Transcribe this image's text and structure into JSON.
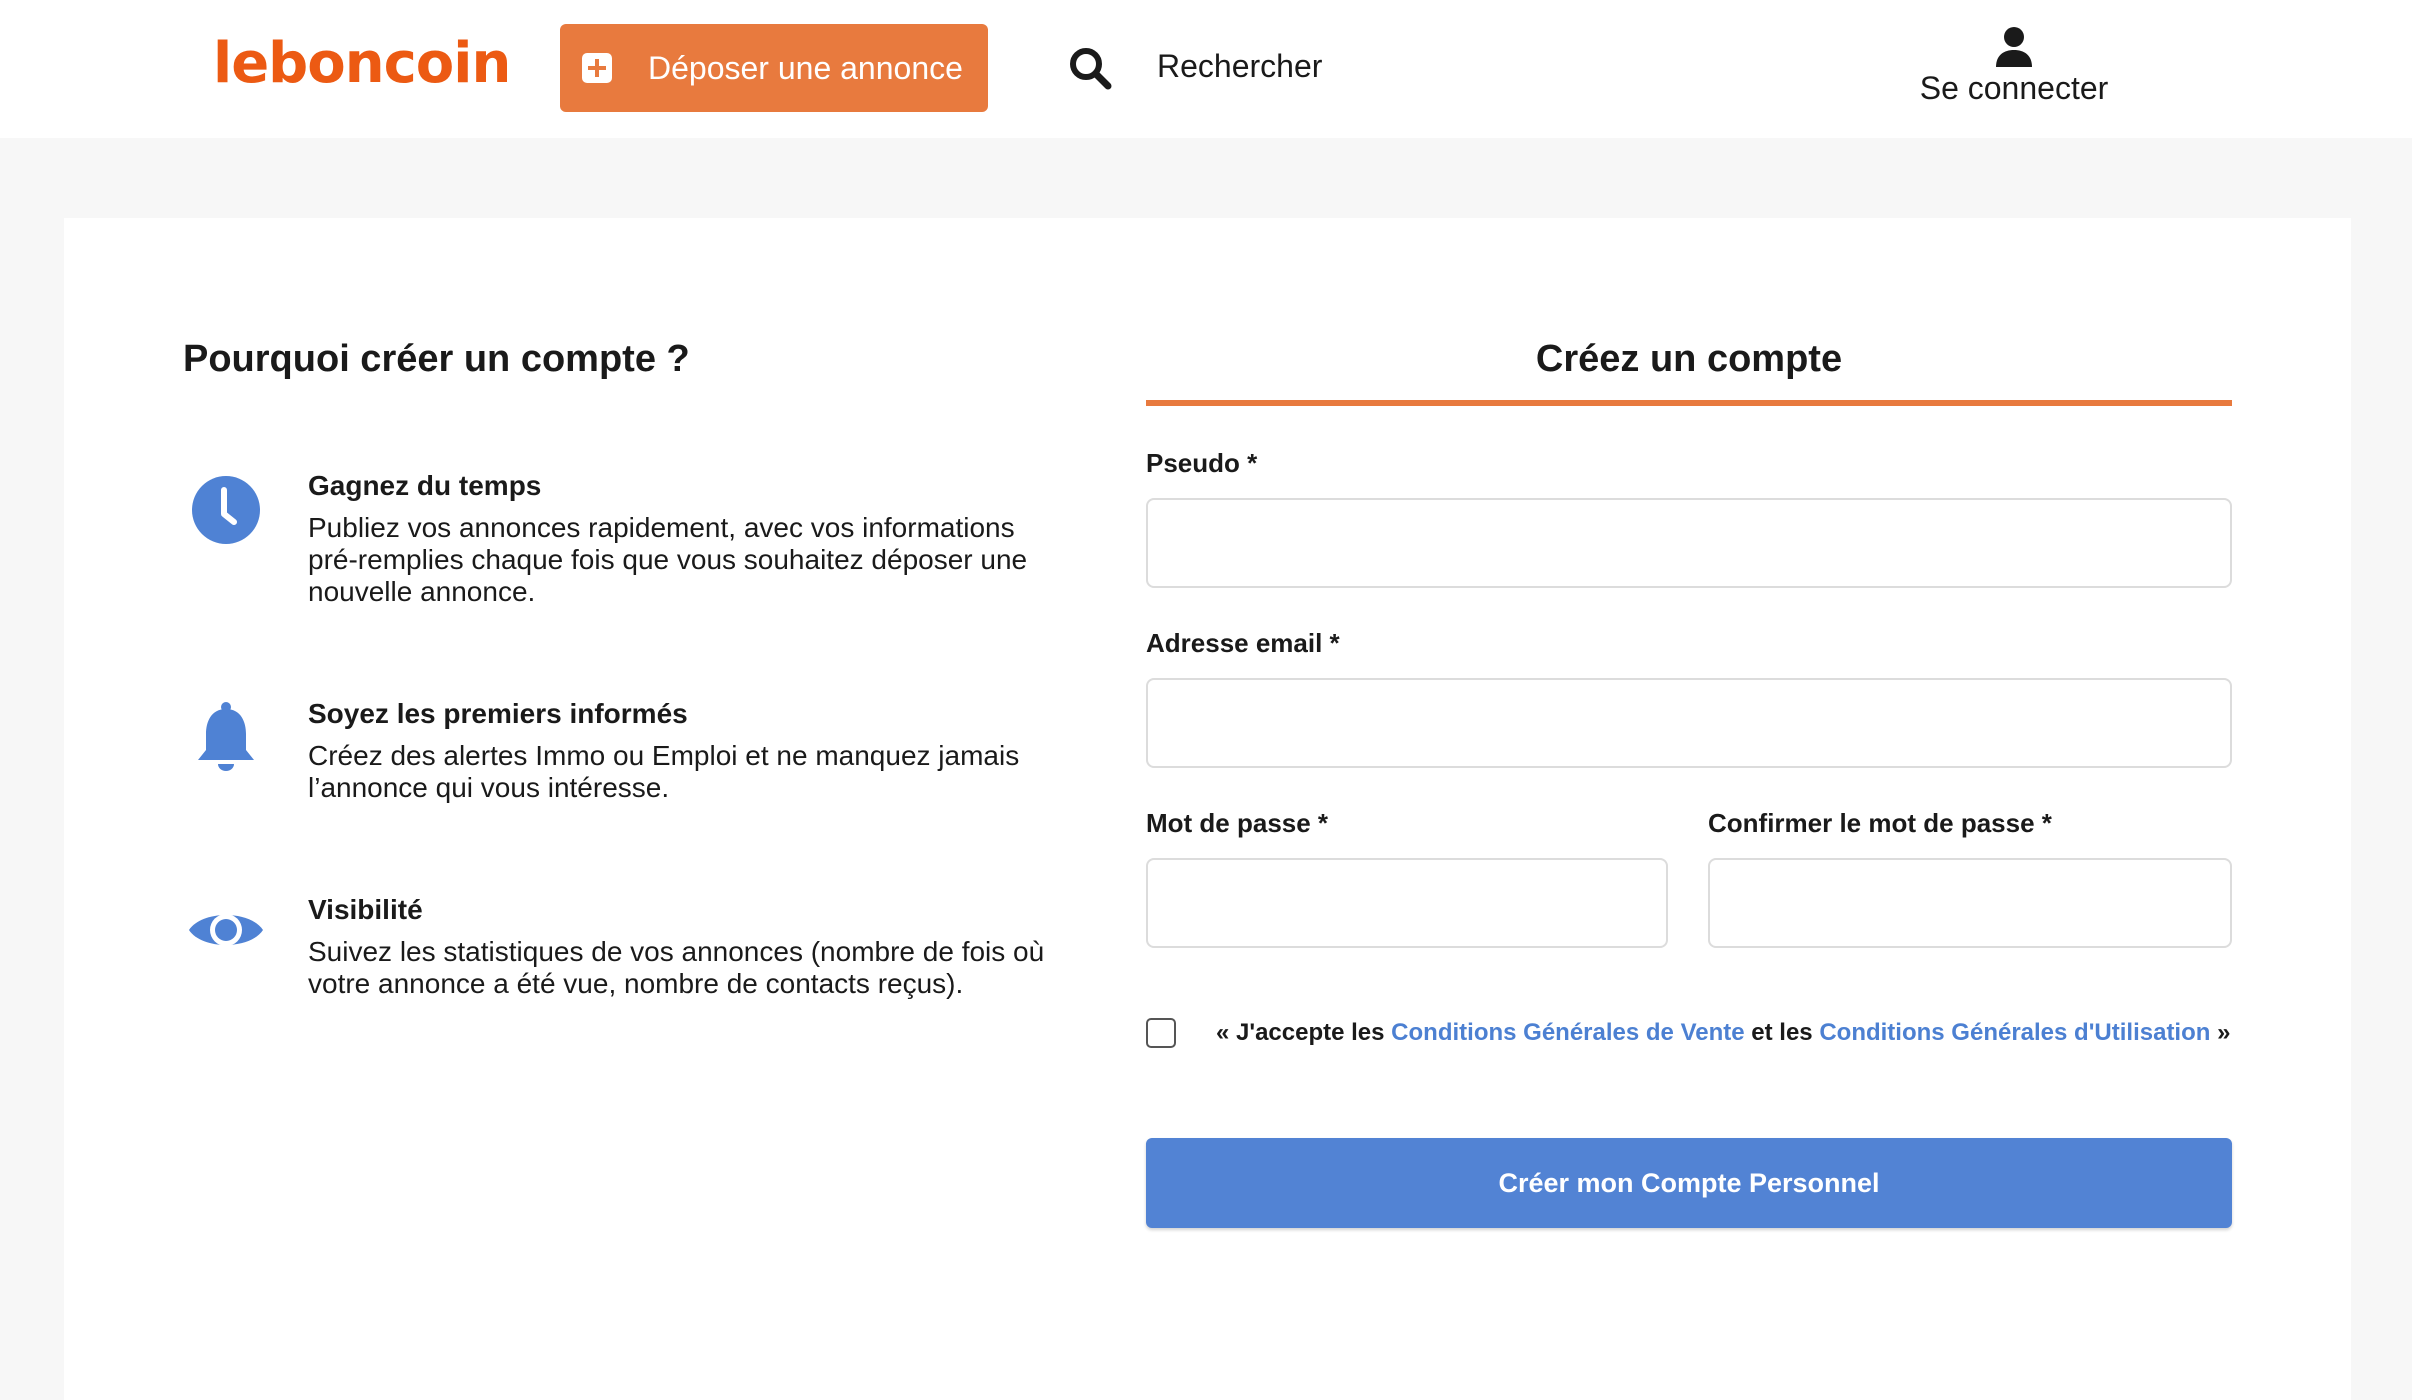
{
  "header": {
    "logo_text": "leboncoin",
    "post_ad_label": "Déposer une annonce",
    "search_label": "Rechercher",
    "login_label": "Se connecter"
  },
  "why": {
    "title": "Pourquoi créer un compte ?",
    "features": [
      {
        "icon": "clock-icon",
        "title": "Gagnez du temps",
        "text": "Publiez vos annonces rapidement, avec vos informations pré-remplies chaque fois que vous souhaitez déposer une nouvelle annonce."
      },
      {
        "icon": "bell-icon",
        "title": "Soyez les premiers informés",
        "text": "Créez des alertes Immo ou Emploi et ne manquez jamais l’annonce qui vous intéresse."
      },
      {
        "icon": "eye-icon",
        "title": "Visibilité",
        "text": "Suivez les statistiques de vos annonces (nombre de fois où votre annonce a été vue, nombre de contacts reçus)."
      }
    ]
  },
  "form": {
    "title": "Créez un compte",
    "pseudo_label": "Pseudo *",
    "pseudo_value": "",
    "email_label": "Adresse email *",
    "email_value": "",
    "password_label": "Mot de passe *",
    "password_value": "",
    "confirm_label": "Confirmer le mot de passe *",
    "confirm_value": "",
    "terms": {
      "checked": false,
      "prefix": "« J'accepte les ",
      "cgv_link": "Conditions Générales de Vente",
      "middle": " et les ",
      "cgu_link": "Conditions Générales d'Utilisation",
      "suffix": " »"
    },
    "submit_label": "Créer mon Compte Personnel"
  },
  "colors": {
    "brand_orange": "#ec5a13",
    "button_orange": "#e87a3e",
    "primary_blue": "#5283d4",
    "link_blue": "#4c80d2",
    "icon_blue": "#4f82d4"
  }
}
